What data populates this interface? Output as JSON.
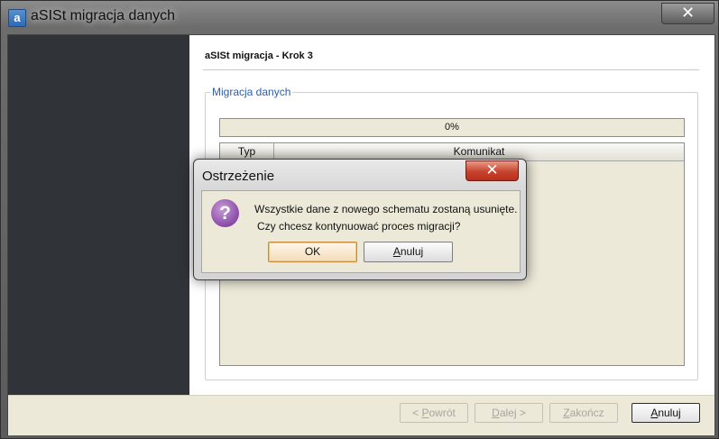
{
  "window": {
    "icon_letter": "a",
    "title": "aSISt migracja danych",
    "close_glyph": "✕"
  },
  "wizard": {
    "step_title": "aSISt migracja - Krok 3",
    "group_label": "Migracja danych",
    "progress_text": "0%",
    "progress_value": 0,
    "table": {
      "columns": [
        "Typ",
        "Komunikat"
      ]
    }
  },
  "buttons": {
    "back": {
      "prefix": "< ",
      "mnemonic": "P",
      "rest": "owrót"
    },
    "next": {
      "mnemonic": "D",
      "rest": "alej >"
    },
    "finish": {
      "mnemonic": "Z",
      "rest": "akończ"
    },
    "cancel": {
      "mnemonic": "A",
      "rest": "nuluj"
    }
  },
  "dialog": {
    "title": "Ostrzeżenie",
    "close_glyph": "✕",
    "icon": "question-icon",
    "icon_glyph": "?",
    "message_line1": "Wszystkie dane z nowego schematu zostaną usunięte.",
    "message_line2": "Czy chcesz kontynuować proces migracji?",
    "ok_label": "OK",
    "cancel": {
      "mnemonic": "A",
      "rest": "nuluj"
    }
  },
  "colors": {
    "sidebar": "#303338",
    "group_legend": "#2e5eab",
    "dialog_close": "#c7432c",
    "question_icon": "#8a4ba7"
  }
}
